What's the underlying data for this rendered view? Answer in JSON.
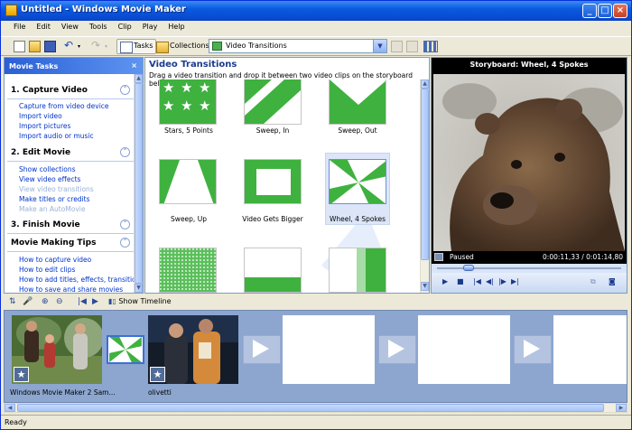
{
  "window": {
    "title": "Untitled - Windows Movie Maker",
    "minimize": "_",
    "maximize": "□",
    "close": "×"
  },
  "menu": [
    "File",
    "Edit",
    "View",
    "Tools",
    "Clip",
    "Play",
    "Help"
  ],
  "toolbar": {
    "tasks_label": "Tasks",
    "collections_label": "Collections",
    "collection_select": "Video Transitions"
  },
  "tasks_pane": {
    "title": "Movie Tasks",
    "close": "×",
    "sections": [
      {
        "title": "1. Capture Video",
        "state": "expanded",
        "links": [
          {
            "label": "Capture from video device",
            "enabled": true
          },
          {
            "label": "Import video",
            "enabled": true
          },
          {
            "label": "Import pictures",
            "enabled": true
          },
          {
            "label": "Import audio or music",
            "enabled": true
          }
        ]
      },
      {
        "title": "2. Edit Movie",
        "state": "expanded",
        "links": [
          {
            "label": "Show collections",
            "enabled": true
          },
          {
            "label": "View video effects",
            "enabled": true
          },
          {
            "label": "View video transitions",
            "enabled": false
          },
          {
            "label": "Make titles or credits",
            "enabled": true
          },
          {
            "label": "Make an AutoMovie",
            "enabled": false
          }
        ]
      },
      {
        "title": "3. Finish Movie",
        "state": "collapsed",
        "links": []
      },
      {
        "title": "Movie Making Tips",
        "state": "expanded",
        "links": [
          {
            "label": "How to capture video",
            "enabled": true
          },
          {
            "label": "How to edit clips",
            "enabled": true
          },
          {
            "label": "How to add titles, effects, transitions",
            "enabled": true
          },
          {
            "label": "How to save and share movies",
            "enabled": true
          }
        ]
      }
    ]
  },
  "transitions": {
    "title": "Video Transitions",
    "subtitle": "Drag a video transition and drop it between two video clips on the storyboard below.",
    "items": [
      {
        "label": "Stars, 5 Points",
        "selected": false
      },
      {
        "label": "Sweep, In",
        "selected": false
      },
      {
        "label": "Sweep, Out",
        "selected": false
      },
      {
        "label": "Sweep, Up",
        "selected": false
      },
      {
        "label": "Video Gets Bigger",
        "selected": false
      },
      {
        "label": "Wheel, 4 Spokes",
        "selected": true
      },
      {
        "label": "",
        "selected": false
      },
      {
        "label": "",
        "selected": false
      },
      {
        "label": "",
        "selected": false
      }
    ],
    "colors": {
      "green": "#3fb13f",
      "light": "#ffffff"
    }
  },
  "preview": {
    "title": "Storyboard: Wheel, 4 Spokes",
    "status": "Paused",
    "time": "0:00:11,33 / 0:01:14,80",
    "seek_fraction": 0.15
  },
  "storyboard": {
    "toolbar_label": "Show Timeline",
    "clips": [
      {
        "label": "Windows Movie Maker 2 Sam..."
      },
      {
        "label": "olivetti"
      }
    ]
  },
  "statusbar": {
    "text": "Ready"
  }
}
